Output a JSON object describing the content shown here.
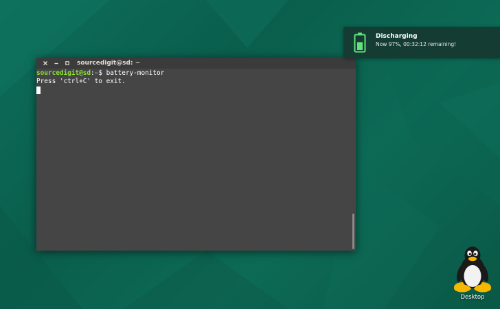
{
  "desktop": {
    "background_color": "#0b6452",
    "icon_label": "Desktop",
    "icon": "tux-penguin-icon"
  },
  "terminal": {
    "title": "sourcedigit@sd: ~",
    "buttons": {
      "close": "close-icon",
      "minimize": "minimize-icon",
      "maximize": "maximize-icon"
    },
    "prompt": {
      "user_host": "sourcedigit@sd",
      "separator": ":",
      "dir": "~",
      "symbol": "$ "
    },
    "command": "battery-monitor",
    "output_line": "Press 'ctrl+C' to exit.",
    "colors": {
      "background": "#454545",
      "prompt_user": "#8ae234",
      "prompt_dir": "#729fcf",
      "text": "#ffffff"
    }
  },
  "notification": {
    "icon": "battery-icon",
    "title": "Discharging",
    "body": "Now 97%, 00:32:12 remaining!",
    "battery_level": 0.97,
    "accent": "#62e27a"
  }
}
